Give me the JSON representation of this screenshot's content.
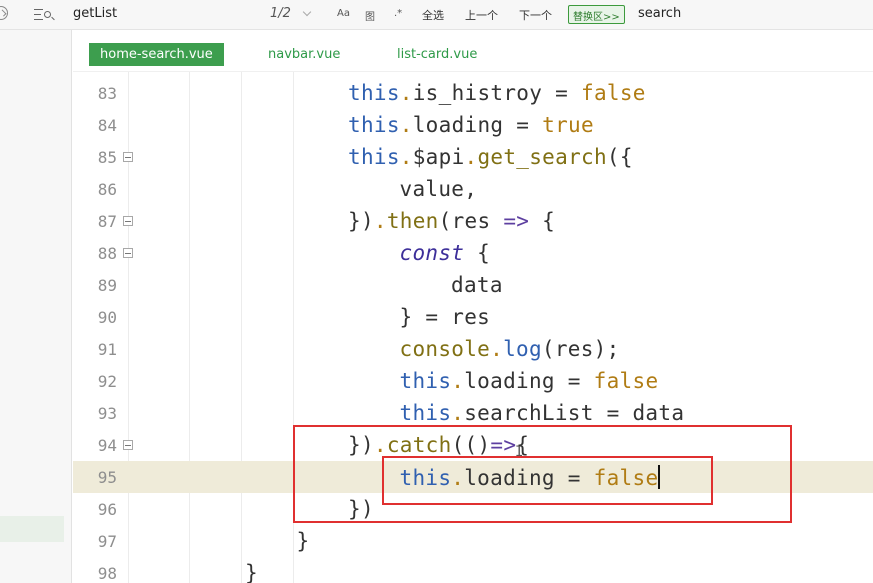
{
  "find_bar": {
    "search_term": "getList",
    "match_count": "1/2",
    "opt_case": "Aa",
    "opt_word": "图",
    "opt_regex": ".*",
    "select_all": "全选",
    "prev": "上一个",
    "next": "下一个",
    "replace_toggle": "替换区>>",
    "replace_term": "search"
  },
  "tabs": [
    {
      "label": "home-search.vue",
      "active": true
    },
    {
      "label": "navbar.vue",
      "active": false
    },
    {
      "label": "list-card.vue",
      "active": false
    }
  ],
  "editor": {
    "current_line": "95",
    "lines": [
      {
        "num": "83",
        "fold": false,
        "indent": 4,
        "tokens": [
          [
            "this",
            "this"
          ],
          [
            ".",
            "dot"
          ],
          [
            "is_histroy = ",
            "plain"
          ],
          [
            "false",
            "bool"
          ]
        ]
      },
      {
        "num": "84",
        "fold": false,
        "indent": 4,
        "tokens": [
          [
            "this",
            "this"
          ],
          [
            ".",
            "dot"
          ],
          [
            "loading = ",
            "plain"
          ],
          [
            "true",
            "bool"
          ]
        ]
      },
      {
        "num": "85",
        "fold": true,
        "indent": 4,
        "tokens": [
          [
            "this",
            "this"
          ],
          [
            ".",
            "dot"
          ],
          [
            "$api",
            "plain"
          ],
          [
            ".",
            "dot"
          ],
          [
            "get_search",
            "fn"
          ],
          [
            "({",
            "plain"
          ]
        ]
      },
      {
        "num": "86",
        "fold": false,
        "indent": 5,
        "tokens": [
          [
            "value,",
            "plain"
          ]
        ]
      },
      {
        "num": "87",
        "fold": true,
        "indent": 4,
        "tokens": [
          [
            "})",
            "plain"
          ],
          [
            ".",
            "dot"
          ],
          [
            "then",
            "fn"
          ],
          [
            "(res ",
            "plain"
          ],
          [
            "=>",
            "arrow"
          ],
          [
            " {",
            "plain"
          ]
        ]
      },
      {
        "num": "88",
        "fold": true,
        "indent": 5,
        "tokens": [
          [
            "const",
            "decl"
          ],
          [
            " {",
            "plain"
          ]
        ]
      },
      {
        "num": "89",
        "fold": false,
        "indent": 6,
        "tokens": [
          [
            "data",
            "plain"
          ]
        ]
      },
      {
        "num": "90",
        "fold": false,
        "indent": 5,
        "tokens": [
          [
            "} = res",
            "plain"
          ]
        ]
      },
      {
        "num": "91",
        "fold": false,
        "indent": 5,
        "tokens": [
          [
            "console",
            "fn"
          ],
          [
            ".",
            "dot"
          ],
          [
            "log",
            "this"
          ],
          [
            "(res);",
            "plain"
          ]
        ]
      },
      {
        "num": "92",
        "fold": false,
        "indent": 5,
        "tokens": [
          [
            "this",
            "this"
          ],
          [
            ".",
            "dot"
          ],
          [
            "loading = ",
            "plain"
          ],
          [
            "false",
            "bool"
          ]
        ]
      },
      {
        "num": "93",
        "fold": false,
        "indent": 5,
        "tokens": [
          [
            "this",
            "this"
          ],
          [
            ".",
            "dot"
          ],
          [
            "searchList = data",
            "plain"
          ]
        ]
      },
      {
        "num": "94",
        "fold": true,
        "indent": 4,
        "tokens": [
          [
            "})",
            "plain"
          ],
          [
            ".",
            "dot"
          ],
          [
            "catch",
            "fn"
          ],
          [
            "(()",
            "plain"
          ],
          [
            "=>",
            "arrow"
          ],
          [
            "{",
            "plain"
          ]
        ]
      },
      {
        "num": "95",
        "fold": false,
        "indent": 5,
        "tokens": [
          [
            "this",
            "this"
          ],
          [
            ".",
            "dot"
          ],
          [
            "loading = ",
            "plain"
          ],
          [
            "false",
            "bool"
          ]
        ],
        "cursor": true
      },
      {
        "num": "96",
        "fold": false,
        "indent": 4,
        "tokens": [
          [
            "})",
            "plain"
          ]
        ]
      },
      {
        "num": "97",
        "fold": false,
        "indent": 3,
        "tokens": [
          [
            "}",
            "plain"
          ]
        ]
      },
      {
        "num": "98",
        "fold": false,
        "indent": 2,
        "tokens": [
          [
            "}",
            "plain"
          ]
        ]
      }
    ]
  },
  "colors": {
    "accent_tab": "#3d9e4e",
    "annotation_red": "#e03030",
    "keyword_this": "#3060b0",
    "literal_bool": "#b07c14"
  }
}
